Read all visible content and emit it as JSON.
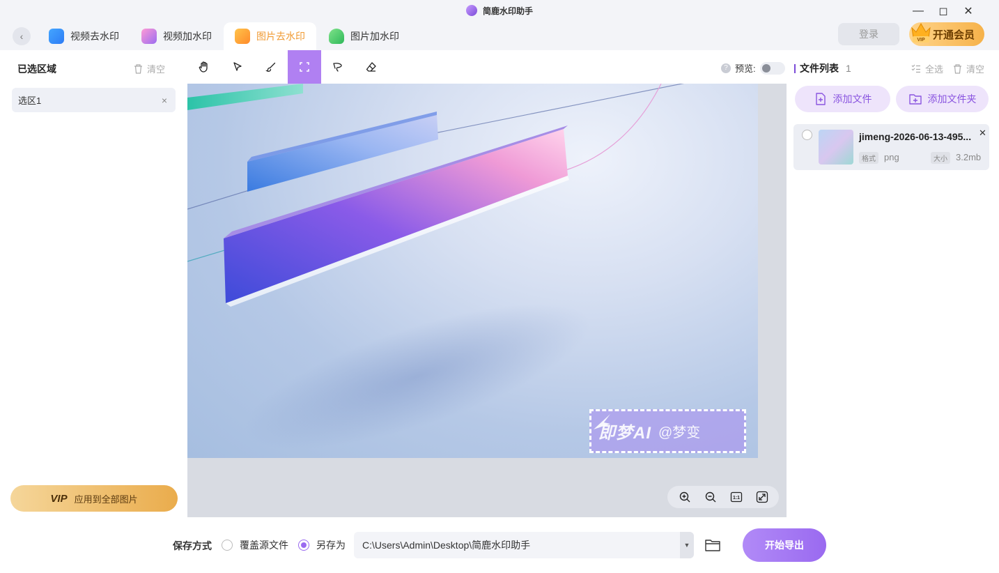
{
  "window": {
    "title": "简鹿水印助手"
  },
  "tabs": [
    {
      "label": "视频去水印"
    },
    {
      "label": "视频加水印"
    },
    {
      "label": "图片去水印"
    },
    {
      "label": "图片加水印"
    }
  ],
  "header": {
    "login_label": "登录",
    "vip_label": "开通会员",
    "vip_badge": "VIP"
  },
  "left_panel": {
    "title": "已选区域",
    "clear_label": "清空",
    "regions": [
      {
        "label": "选区1"
      }
    ],
    "apply_vip_tag": "VIP",
    "apply_label": "应用到全部图片"
  },
  "toolbar": {
    "tools": [
      "hand-icon",
      "pointer-icon",
      "brush-icon",
      "rect-select-icon",
      "lasso-icon",
      "eraser-icon"
    ],
    "active_tool": "rect-select-icon",
    "preview_label": "预览:",
    "preview_enabled": false,
    "accent_color": "#b080f2"
  },
  "canvas": {
    "watermark_text": "即梦AI",
    "watermark_sub": "@梦变",
    "zoom_controls": [
      "zoom-in-icon",
      "zoom-out-icon",
      "actual-size-icon",
      "fit-screen-icon"
    ],
    "actual_size_label": "1:1"
  },
  "right_panel": {
    "title": "文件列表",
    "count": "1",
    "select_all_label": "全选",
    "clear_label": "清空",
    "add_file_label": "添加文件",
    "add_folder_label": "添加文件夹",
    "files": [
      {
        "name": "jimeng-2026-06-13-495...",
        "format_tag": "格式",
        "format": "png",
        "size_tag": "大小",
        "size": "3.2mb"
      }
    ]
  },
  "footer": {
    "save_mode_label": "保存方式",
    "overwrite_label": "覆盖源文件",
    "saveas_label": "另存为",
    "selected_mode": "saveas",
    "output_path": "C:\\Users\\Admin\\Desktop\\简鹿水印助手",
    "export_label": "开始导出"
  }
}
